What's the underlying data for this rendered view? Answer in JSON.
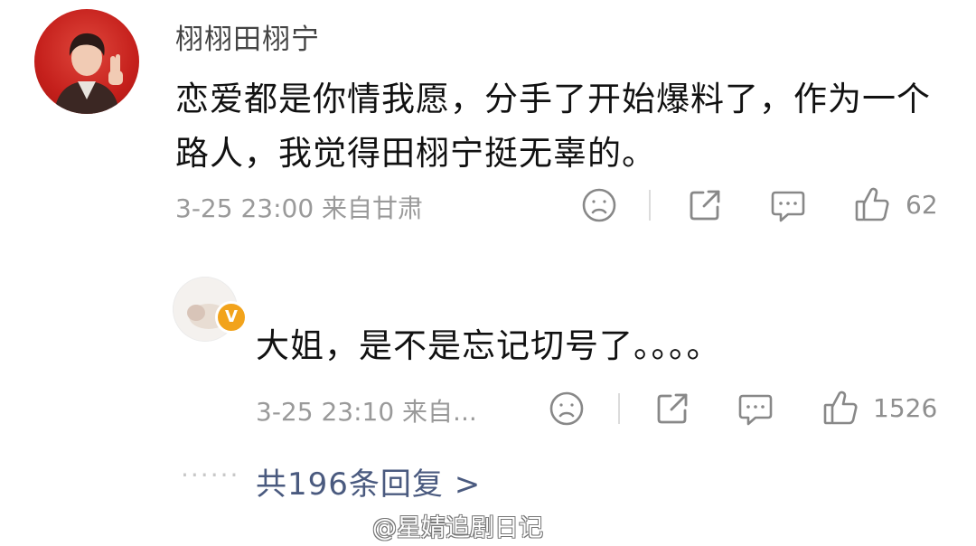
{
  "comment": {
    "username": "栩栩田栩宁",
    "content": "恋爱都是你情我愿，分手了开始爆料了，作为一个路人，我觉得田栩宁挺无辜的。",
    "date": "3-25 23:00",
    "location": "来自甘肃",
    "like_count": "62"
  },
  "reply": {
    "content": "大姐，是不是忘记切号了。。。。",
    "date": "3-25 23:10",
    "location": "来自...",
    "like_count": "1526",
    "badge": "V"
  },
  "more_dots": "······",
  "more_replies": "共196条回复 >",
  "watermark": "@星婧追剧日记",
  "icons": {
    "dislike": "sad-face-icon",
    "share": "share-icon",
    "comment": "comment-icon",
    "like": "thumbs-up-icon"
  },
  "colors": {
    "avatar_bg": "#c5201c",
    "badge": "#f2a31b",
    "link": "#4a5a7f",
    "meta": "#9a9a9a"
  }
}
